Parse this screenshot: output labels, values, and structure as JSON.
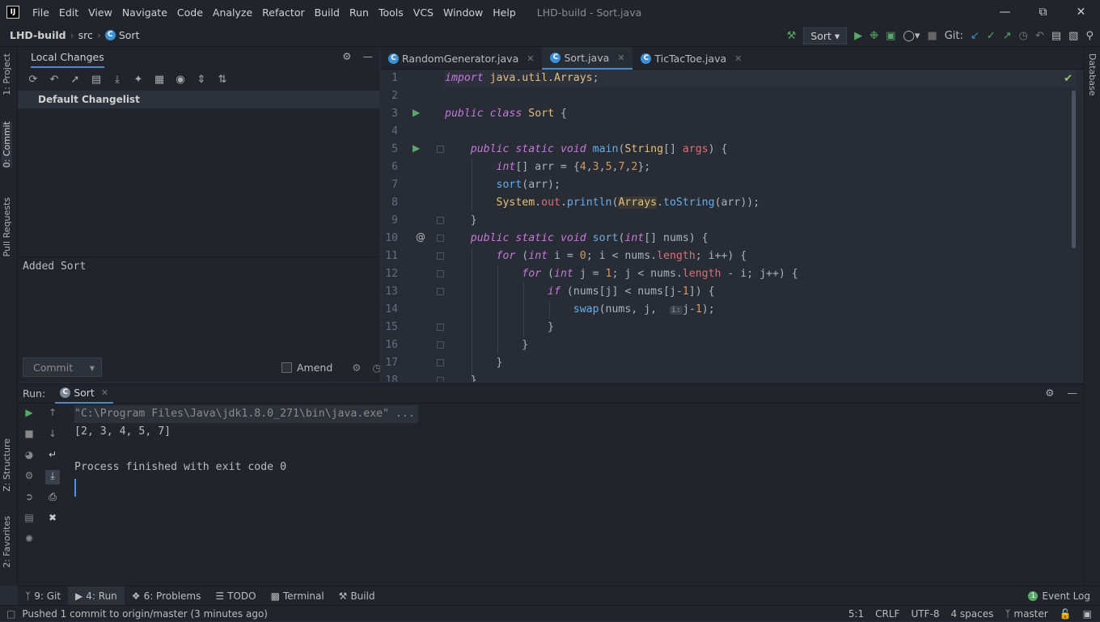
{
  "title_bar": {
    "menus": [
      "File",
      "Edit",
      "View",
      "Navigate",
      "Code",
      "Analyze",
      "Refactor",
      "Build",
      "Run",
      "Tools",
      "VCS",
      "Window",
      "Help"
    ],
    "window_title": "LHD-build - Sort.java"
  },
  "navbar": {
    "project": "LHD-build",
    "folder": "src",
    "file": "Sort",
    "run_config": "Sort",
    "git_label": "Git:"
  },
  "left_stripe": {
    "project": "1: Project",
    "commit": "0: Commit",
    "pull_requests": "Pull Requests",
    "structure": "Z: Structure",
    "favorites": "2: Favorites"
  },
  "right_stripe": {
    "database": "Database"
  },
  "commit_panel": {
    "tab": "Local Changes",
    "changelist": "Default Changelist",
    "message": "Added Sort",
    "commit_button": "Commit",
    "amend_label": "Amend"
  },
  "editor": {
    "tabs": [
      {
        "label": "RandomGenerator.java"
      },
      {
        "label": "Sort.java"
      },
      {
        "label": "TicTacToe.java"
      }
    ],
    "line_numbers": [
      "1",
      "2",
      "3",
      "4",
      "5",
      "6",
      "7",
      "8",
      "9",
      "10",
      "11",
      "12",
      "13",
      "14",
      "15",
      "16",
      "17",
      "18"
    ],
    "code": [
      "import java.util.Arrays;",
      "",
      "public class Sort {",
      "",
      "    public static void main(String[] args) {",
      "        int[] arr = {4,3,5,7,2};",
      "        sort(arr);",
      "        System.out.println(Arrays.toString(arr));",
      "    }",
      "    public static void sort(int[] nums) {",
      "        for (int i = 0; i < nums.length; i++) {",
      "            for (int j = 1; j < nums.length - i; j++) {",
      "                if (nums[j] < nums[j-1]) {",
      "                    swap(nums, j,  i: j-1);",
      "                }",
      "            }",
      "        }",
      "    }"
    ],
    "param_hint": "i:"
  },
  "run_panel": {
    "label": "Run:",
    "tab": "Sort",
    "console": [
      "\"C:\\Program Files\\Java\\jdk1.8.0_271\\bin\\java.exe\" ...",
      "[2, 3, 4, 5, 7]",
      "",
      "Process finished with exit code 0"
    ]
  },
  "bottom_tabs": [
    {
      "label": "9: Git"
    },
    {
      "label": "4: Run"
    },
    {
      "label": "6: Problems"
    },
    {
      "label": "TODO"
    },
    {
      "label": "Terminal"
    },
    {
      "label": "Build"
    }
  ],
  "event_log": "Event Log",
  "status_bar": {
    "message": "Pushed 1 commit to origin/master (3 minutes ago)",
    "position": "5:1",
    "line_sep": "CRLF",
    "encoding": "UTF-8",
    "indent": "4 spaces",
    "branch": "master"
  }
}
